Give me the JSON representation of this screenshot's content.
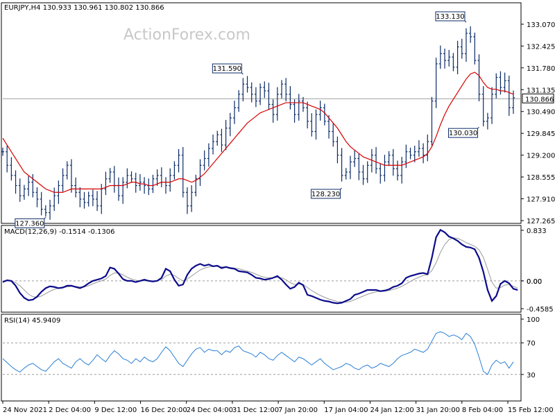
{
  "chart_data": {
    "type": "line",
    "symbol_header": "EURJPY,H4  130.933 130.961 130.802 130.866",
    "watermark": "ActionForex.com",
    "last_price": "130.866",
    "price_panel": {
      "ylim": [
        127.265,
        133.335
      ],
      "y_ticks": [
        "133.070",
        "132.425",
        "131.780",
        "131.135",
        "130.490",
        "129.845",
        "129.200",
        "128.555",
        "127.910",
        "127.265"
      ],
      "y_tick_values": [
        133.07,
        132.425,
        131.78,
        131.135,
        130.49,
        129.845,
        129.2,
        128.555,
        127.91,
        127.265
      ],
      "annotations": [
        {
          "label": "131.590",
          "index": 56,
          "value": 131.59
        },
        {
          "label": "127.360",
          "index": 10,
          "value": 127.36
        },
        {
          "label": "128.230",
          "index": 79,
          "value": 128.23
        },
        {
          "label": "133.130",
          "index": 108,
          "value": 133.13
        },
        {
          "label": "130.030",
          "index": 111,
          "value": 130.03
        }
      ],
      "series": [
        {
          "kind": "ohlc_close",
          "color": "#0a2a66",
          "values": [
            129.3,
            128.9,
            128.6,
            128.3,
            128.0,
            128.2,
            128.4,
            128.1,
            127.9,
            127.6,
            127.5,
            127.7,
            128.0,
            128.3,
            128.6,
            128.9,
            128.3,
            128.1,
            127.9,
            127.8,
            128.0,
            127.9,
            127.7,
            128.2,
            128.5,
            128.7,
            128.3,
            128.0,
            128.4,
            128.6,
            128.5,
            128.3,
            128.4,
            128.3,
            128.2,
            128.5,
            128.6,
            128.4,
            128.3,
            128.6,
            128.9,
            129.2,
            128.1,
            127.7,
            128.1,
            128.5,
            128.9,
            129.1,
            129.4,
            129.6,
            129.8,
            129.5,
            130.0,
            130.3,
            130.6,
            131.0,
            131.3,
            131.2,
            131.0,
            130.8,
            131.2,
            131.1,
            130.7,
            130.4,
            131.0,
            131.3,
            131.0,
            130.7,
            130.4,
            130.8,
            130.6,
            130.2,
            129.9,
            130.4,
            130.6,
            130.2,
            129.9,
            129.6,
            129.2,
            128.6,
            128.7,
            129.0,
            129.1,
            128.7,
            128.5,
            128.9,
            129.2,
            128.8,
            128.6,
            129.0,
            129.2,
            128.8,
            128.6,
            129.0,
            129.3,
            129.2,
            129.3,
            129.4,
            129.2,
            129.6,
            130.8,
            131.9,
            132.2,
            132.0,
            132.1,
            131.8,
            132.4,
            132.2,
            132.8,
            132.7,
            132.0,
            131.0,
            130.2,
            130.3,
            131.0,
            131.5,
            131.2,
            131.4,
            130.6,
            130.9
          ]
        },
        {
          "kind": "moving_average",
          "color": "#d40000",
          "values": [
            129.7,
            129.5,
            129.3,
            129.1,
            128.9,
            128.7,
            128.6,
            128.5,
            128.4,
            128.3,
            128.2,
            128.15,
            128.1,
            128.1,
            128.1,
            128.15,
            128.2,
            128.2,
            128.2,
            128.2,
            128.2,
            128.2,
            128.2,
            128.2,
            128.25,
            128.3,
            128.3,
            128.3,
            128.3,
            128.35,
            128.4,
            128.4,
            128.35,
            128.35,
            128.3,
            128.3,
            128.35,
            128.4,
            128.4,
            128.4,
            128.45,
            128.5,
            128.5,
            128.45,
            128.4,
            128.45,
            128.55,
            128.65,
            128.8,
            128.95,
            129.1,
            129.25,
            129.4,
            129.55,
            129.7,
            129.85,
            130.0,
            130.15,
            130.25,
            130.35,
            130.45,
            130.5,
            130.55,
            130.6,
            130.65,
            130.7,
            130.75,
            130.75,
            130.75,
            130.75,
            130.75,
            130.7,
            130.65,
            130.6,
            130.55,
            130.45,
            130.3,
            130.15,
            130.0,
            129.8,
            129.6,
            129.45,
            129.35,
            129.25,
            129.15,
            129.1,
            129.05,
            129.0,
            128.95,
            128.9,
            128.9,
            128.9,
            128.9,
            128.9,
            128.95,
            129.0,
            129.05,
            129.1,
            129.15,
            129.25,
            129.45,
            129.75,
            130.1,
            130.4,
            130.65,
            130.85,
            131.05,
            131.25,
            131.45,
            131.6,
            131.65,
            131.55,
            131.35,
            131.2,
            131.15,
            131.15,
            131.1,
            131.1,
            131.05,
            131.0
          ]
        }
      ]
    },
    "macd_panel": {
      "label": "MACD(12,26,9) -0.1514 -0.1306",
      "ylim": [
        -0.4585,
        0.833
      ],
      "y_ticks": [
        "0.833",
        "0.00",
        "0.00",
        "-0.4585"
      ],
      "y_tick_values": [
        0.833,
        0.0,
        0.0,
        -0.4585
      ],
      "dotted_level": 0.0,
      "series": [
        {
          "name": "MACD",
          "color": "#0a0a8a",
          "values": [
            -0.02,
            0.01,
            0.0,
            -0.08,
            -0.2,
            -0.28,
            -0.32,
            -0.31,
            -0.26,
            -0.18,
            -0.12,
            -0.09,
            -0.1,
            -0.12,
            -0.11,
            -0.08,
            -0.08,
            -0.1,
            -0.12,
            -0.09,
            -0.04,
            0.0,
            0.02,
            0.04,
            0.08,
            0.22,
            0.2,
            0.12,
            0.03,
            0.0,
            0.0,
            -0.02,
            0.0,
            0.02,
            0.0,
            -0.01,
            0.0,
            0.05,
            0.2,
            0.16,
            0.02,
            -0.08,
            -0.06,
            0.1,
            0.2,
            0.25,
            0.28,
            0.25,
            0.27,
            0.24,
            0.25,
            0.21,
            0.23,
            0.21,
            0.2,
            0.16,
            0.15,
            0.14,
            0.1,
            0.05,
            0.04,
            0.02,
            0.03,
            0.05,
            0.08,
            0.02,
            -0.06,
            -0.13,
            -0.1,
            -0.03,
            -0.07,
            -0.23,
            -0.25,
            -0.28,
            -0.31,
            -0.33,
            -0.34,
            -0.36,
            -0.37,
            -0.36,
            -0.33,
            -0.3,
            -0.23,
            -0.21,
            -0.18,
            -0.15,
            -0.15,
            -0.15,
            -0.17,
            -0.16,
            -0.14,
            -0.1,
            -0.08,
            -0.04,
            0.05,
            0.08,
            0.1,
            0.12,
            0.13,
            0.11,
            0.38,
            0.72,
            0.84,
            0.8,
            0.73,
            0.7,
            0.66,
            0.6,
            0.56,
            0.55,
            0.52,
            0.38,
            0.15,
            -0.15,
            -0.33,
            -0.25,
            -0.05,
            0.0,
            -0.04,
            -0.13,
            -0.15
          ]
        },
        {
          "name": "Signal",
          "color": "#9a9a9a",
          "values": [
            0.0,
            0.0,
            0.0,
            -0.03,
            -0.08,
            -0.15,
            -0.22,
            -0.26,
            -0.27,
            -0.25,
            -0.21,
            -0.17,
            -0.14,
            -0.12,
            -0.11,
            -0.1,
            -0.09,
            -0.09,
            -0.1,
            -0.1,
            -0.08,
            -0.05,
            -0.02,
            0.0,
            0.03,
            0.09,
            0.13,
            0.13,
            0.1,
            0.06,
            0.03,
            0.01,
            0.0,
            0.0,
            0.0,
            0.0,
            0.0,
            0.02,
            0.08,
            0.11,
            0.09,
            0.04,
            0.0,
            0.03,
            0.08,
            0.13,
            0.18,
            0.21,
            0.23,
            0.24,
            0.24,
            0.23,
            0.23,
            0.22,
            0.21,
            0.2,
            0.18,
            0.16,
            0.14,
            0.11,
            0.08,
            0.06,
            0.05,
            0.05,
            0.06,
            0.05,
            0.02,
            -0.03,
            -0.06,
            -0.05,
            -0.06,
            -0.11,
            -0.16,
            -0.2,
            -0.24,
            -0.27,
            -0.3,
            -0.32,
            -0.34,
            -0.35,
            -0.35,
            -0.34,
            -0.31,
            -0.28,
            -0.25,
            -0.22,
            -0.2,
            -0.18,
            -0.17,
            -0.17,
            -0.16,
            -0.14,
            -0.12,
            -0.09,
            -0.05,
            -0.01,
            0.03,
            0.06,
            0.09,
            0.1,
            0.17,
            0.3,
            0.47,
            0.6,
            0.68,
            0.71,
            0.7,
            0.67,
            0.63,
            0.6,
            0.57,
            0.51,
            0.39,
            0.19,
            -0.02,
            -0.12,
            -0.11,
            -0.07,
            -0.06,
            -0.09,
            -0.12
          ]
        }
      ]
    },
    "rsi_panel": {
      "label": "RSI(14) 45.9409",
      "ylim": [
        0,
        100
      ],
      "y_ticks": [
        "100",
        "70",
        "30"
      ],
      "y_tick_values": [
        100,
        70,
        30
      ],
      "dotted_levels": [
        70,
        30
      ],
      "series": [
        {
          "name": "RSI",
          "color": "#2a7fd4",
          "values": [
            50,
            45,
            40,
            36,
            33,
            38,
            42,
            44,
            40,
            36,
            34,
            40,
            46,
            50,
            44,
            41,
            38,
            46,
            50,
            45,
            42,
            48,
            55,
            50,
            46,
            54,
            60,
            56,
            50,
            48,
            44,
            50,
            46,
            52,
            48,
            46,
            50,
            58,
            65,
            60,
            52,
            44,
            40,
            48,
            56,
            62,
            64,
            58,
            62,
            60,
            60,
            55,
            60,
            58,
            64,
            66,
            60,
            58,
            56,
            52,
            58,
            55,
            50,
            48,
            54,
            58,
            54,
            50,
            46,
            52,
            50,
            46,
            42,
            46,
            50,
            44,
            40,
            36,
            38,
            40,
            44,
            42,
            38,
            36,
            40,
            42,
            38,
            40,
            44,
            42,
            40,
            44,
            50,
            54,
            56,
            58,
            62,
            60,
            58,
            62,
            72,
            82,
            84,
            82,
            78,
            80,
            78,
            74,
            82,
            78,
            68,
            52,
            34,
            30,
            42,
            48,
            44,
            46,
            38,
            45.9
          ]
        }
      ]
    },
    "x_ticks": [
      {
        "label": "24 Nov 2021",
        "index": 0
      },
      {
        "label": "2 Dec 04:00",
        "index": 12
      },
      {
        "label": "9 Dec 12:00",
        "index": 24
      },
      {
        "label": "16 Dec 20:00",
        "index": 36
      },
      {
        "label": "24 Dec 04:00",
        "index": 48
      },
      {
        "label": "31 Dec 12:00",
        "index": 60
      },
      {
        "label": "7 Jan 20:00",
        "index": 72
      },
      {
        "label": "17 Jan 04:00",
        "index": 84
      },
      {
        "label": "24 Jan 12:00",
        "index": 96
      },
      {
        "label": "31 Jan 20:00",
        "index": 108
      },
      {
        "label": "8 Feb 04:00",
        "index": 120
      },
      {
        "label": "15 Feb 12:00",
        "index": 132
      }
    ]
  }
}
